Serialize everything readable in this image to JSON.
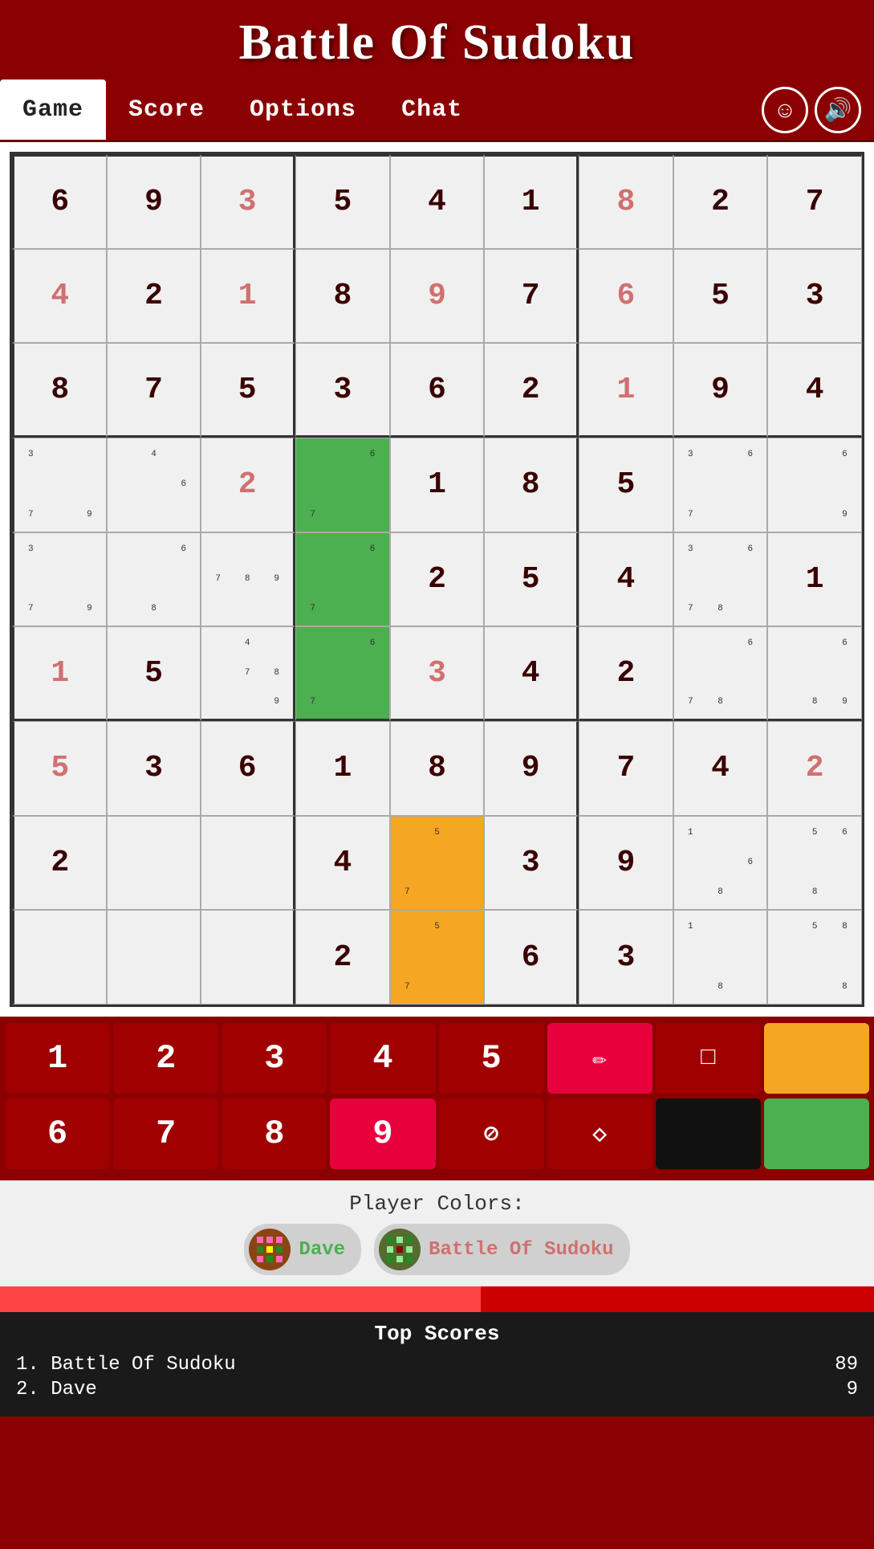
{
  "app": {
    "title": "Battle Of Sudoku"
  },
  "nav": {
    "tabs": [
      {
        "label": "Game",
        "active": true
      },
      {
        "label": "Score",
        "active": false
      },
      {
        "label": "Options",
        "active": false
      },
      {
        "label": "Chat",
        "active": false
      }
    ],
    "emoji_icon": "☺",
    "sound_icon": "🔊"
  },
  "grid": {
    "rows": [
      [
        {
          "val": "6",
          "type": "dark",
          "notes": []
        },
        {
          "val": "9",
          "type": "dark",
          "notes": []
        },
        {
          "val": "3",
          "type": "light",
          "notes": []
        },
        {
          "val": "5",
          "type": "dark",
          "notes": []
        },
        {
          "val": "4",
          "type": "dark",
          "notes": []
        },
        {
          "val": "1",
          "type": "dark",
          "notes": []
        },
        {
          "val": "8",
          "type": "light",
          "notes": []
        },
        {
          "val": "2",
          "type": "dark",
          "notes": []
        },
        {
          "val": "7",
          "type": "dark",
          "notes": []
        }
      ],
      [
        {
          "val": "4",
          "type": "light",
          "notes": []
        },
        {
          "val": "2",
          "type": "dark",
          "notes": []
        },
        {
          "val": "1",
          "type": "light",
          "notes": []
        },
        {
          "val": "8",
          "type": "dark",
          "notes": []
        },
        {
          "val": "9",
          "type": "light",
          "notes": []
        },
        {
          "val": "7",
          "type": "dark",
          "notes": []
        },
        {
          "val": "6",
          "type": "light",
          "notes": []
        },
        {
          "val": "5",
          "type": "dark",
          "notes": []
        },
        {
          "val": "3",
          "type": "dark",
          "notes": []
        }
      ],
      [
        {
          "val": "8",
          "type": "dark",
          "notes": []
        },
        {
          "val": "7",
          "type": "dark",
          "notes": []
        },
        {
          "val": "5",
          "type": "dark",
          "notes": []
        },
        {
          "val": "3",
          "type": "dark",
          "notes": []
        },
        {
          "val": "6",
          "type": "dark",
          "notes": []
        },
        {
          "val": "2",
          "type": "dark",
          "notes": []
        },
        {
          "val": "1",
          "type": "light",
          "notes": []
        },
        {
          "val": "9",
          "type": "dark",
          "notes": []
        },
        {
          "val": "4",
          "type": "dark",
          "notes": []
        }
      ],
      [
        {
          "val": "",
          "type": "dark",
          "notes": [
            "3",
            "",
            "",
            "",
            "",
            "",
            "7",
            "",
            "9"
          ]
        },
        {
          "val": "",
          "type": "dark",
          "notes": [
            "",
            "4",
            "",
            "",
            "",
            "6",
            "",
            "",
            ""
          ]
        },
        {
          "val": "2",
          "type": "light",
          "notes": []
        },
        {
          "val": "",
          "type": "green",
          "notes": [
            "",
            "",
            "6",
            "",
            "",
            "",
            "7",
            "",
            ""
          ]
        },
        {
          "val": "1",
          "type": "dark",
          "notes": []
        },
        {
          "val": "8",
          "type": "dark",
          "notes": []
        },
        {
          "val": "5",
          "type": "dark",
          "notes": []
        },
        {
          "val": "",
          "type": "dark",
          "notes": [
            "3",
            "",
            "6",
            "",
            "",
            "",
            "7",
            "",
            ""
          ]
        },
        {
          "val": "",
          "type": "dark",
          "notes": [
            "",
            "",
            "6",
            "",
            "",
            "",
            "",
            "",
            "9"
          ]
        }
      ],
      [
        {
          "val": "",
          "type": "dark",
          "notes": [
            "3",
            "",
            "",
            "",
            "",
            "",
            "7",
            "",
            "9"
          ]
        },
        {
          "val": "",
          "type": "dark",
          "notes": [
            "",
            "",
            "6",
            "",
            "",
            "",
            "",
            "8",
            ""
          ]
        },
        {
          "val": "",
          "type": "dark",
          "notes": [
            "",
            "",
            "",
            "7",
            "8",
            "9",
            "",
            "",
            ""
          ]
        },
        {
          "val": "",
          "type": "green",
          "notes": [
            "",
            "",
            "6",
            "",
            "",
            "",
            "7",
            "",
            ""
          ]
        },
        {
          "val": "2",
          "type": "dark",
          "notes": []
        },
        {
          "val": "5",
          "type": "dark",
          "notes": []
        },
        {
          "val": "4",
          "type": "dark",
          "notes": []
        },
        {
          "val": "",
          "type": "dark",
          "notes": [
            "3",
            "",
            "6",
            "",
            "",
            "",
            "7",
            "8",
            ""
          ]
        },
        {
          "val": "1",
          "type": "dark",
          "notes": []
        }
      ],
      [
        {
          "val": "1",
          "type": "light",
          "notes": []
        },
        {
          "val": "5",
          "type": "dark",
          "notes": []
        },
        {
          "val": "",
          "type": "dark",
          "notes": [
            "",
            "4",
            "",
            "",
            "7",
            "8",
            "",
            "",
            "9"
          ]
        },
        {
          "val": "",
          "type": "green",
          "notes": [
            "",
            "",
            "6",
            "",
            "",
            "",
            "7",
            "",
            ""
          ]
        },
        {
          "val": "3",
          "type": "light",
          "notes": []
        },
        {
          "val": "4",
          "type": "dark",
          "notes": []
        },
        {
          "val": "2",
          "type": "dark",
          "notes": []
        },
        {
          "val": "",
          "type": "dark",
          "notes": [
            "",
            "",
            "6",
            "",
            "",
            "",
            "7",
            "8",
            ""
          ]
        },
        {
          "val": "",
          "type": "dark",
          "notes": [
            "",
            "",
            "6",
            "",
            "",
            "",
            "",
            "8",
            "9"
          ]
        }
      ],
      [
        {
          "val": "5",
          "type": "light",
          "notes": []
        },
        {
          "val": "3",
          "type": "dark",
          "notes": []
        },
        {
          "val": "6",
          "type": "dark",
          "notes": []
        },
        {
          "val": "1",
          "type": "dark",
          "notes": []
        },
        {
          "val": "8",
          "type": "dark",
          "notes": []
        },
        {
          "val": "9",
          "type": "dark",
          "notes": []
        },
        {
          "val": "7",
          "type": "dark",
          "notes": []
        },
        {
          "val": "4",
          "type": "dark",
          "notes": []
        },
        {
          "val": "2",
          "type": "light",
          "notes": []
        }
      ],
      [
        {
          "val": "2",
          "type": "dark",
          "notes": []
        },
        {
          "val": "",
          "type": "dark",
          "notes": []
        },
        {
          "val": "",
          "type": "dark",
          "notes": []
        },
        {
          "val": "4",
          "type": "dark",
          "notes": []
        },
        {
          "val": "",
          "type": "orange",
          "notes": [
            "",
            "5",
            "",
            "",
            "",
            "",
            "7",
            "",
            ""
          ]
        },
        {
          "val": "3",
          "type": "dark",
          "notes": []
        },
        {
          "val": "9",
          "type": "dark",
          "notes": []
        },
        {
          "val": "",
          "type": "dark",
          "notes": [
            "1",
            "",
            "",
            "",
            "",
            "6",
            "",
            "8",
            ""
          ]
        },
        {
          "val": "",
          "type": "dark",
          "notes": [
            "",
            "5",
            "6",
            "",
            "",
            "",
            "",
            "8",
            ""
          ]
        }
      ],
      [
        {
          "val": "",
          "type": "dark",
          "notes": []
        },
        {
          "val": "",
          "type": "dark",
          "notes": []
        },
        {
          "val": "",
          "type": "dark",
          "notes": []
        },
        {
          "val": "2",
          "type": "dark",
          "notes": []
        },
        {
          "val": "",
          "type": "orange",
          "notes": [
            "",
            "5",
            "",
            "",
            "",
            "",
            "7",
            "",
            ""
          ]
        },
        {
          "val": "6",
          "type": "dark",
          "notes": []
        },
        {
          "val": "3",
          "type": "dark",
          "notes": []
        },
        {
          "val": "",
          "type": "dark",
          "notes": [
            "1",
            "",
            "",
            "",
            "",
            "",
            "",
            "8",
            ""
          ]
        },
        {
          "val": "",
          "type": "dark",
          "notes": [
            "",
            "5",
            "8",
            "",
            "",
            "",
            "",
            "",
            "8"
          ]
        }
      ]
    ]
  },
  "numpad": {
    "row1": [
      {
        "label": "1",
        "active": false
      },
      {
        "label": "2",
        "active": false
      },
      {
        "label": "3",
        "active": false
      },
      {
        "label": "4",
        "active": false
      },
      {
        "label": "5",
        "active": false
      },
      {
        "label": "✏",
        "active": true,
        "icon": true
      },
      {
        "label": "□",
        "active": false,
        "icon": true
      },
      {
        "label": "▪",
        "active": false,
        "icon": true,
        "color": "orange"
      }
    ],
    "row2": [
      {
        "label": "6",
        "active": false
      },
      {
        "label": "7",
        "active": false
      },
      {
        "label": "8",
        "active": false
      },
      {
        "label": "9",
        "active": true
      },
      {
        "label": "⊘",
        "active": false,
        "icon": true
      },
      {
        "label": "◇",
        "active": false,
        "icon": true
      },
      {
        "label": "■",
        "active": false,
        "icon": true,
        "color": "black"
      },
      {
        "label": "▪",
        "active": false,
        "icon": true,
        "color": "green"
      }
    ]
  },
  "player_colors": {
    "label": "Player Colors:",
    "players": [
      {
        "name": "Dave",
        "name_class": "p1-name",
        "avatar_class": "p1",
        "avatar_emoji": "🎮"
      },
      {
        "name": "Battle Of Sudoku",
        "name_class": "p2-name",
        "avatar_class": "p2",
        "avatar_emoji": "🎮"
      }
    ]
  },
  "top_scores": {
    "title": "Top Scores",
    "entries": [
      {
        "rank": "1.",
        "name": "Battle Of Sudoku",
        "score": "89"
      },
      {
        "rank": "2.",
        "name": "Dave",
        "score": "9"
      }
    ]
  }
}
